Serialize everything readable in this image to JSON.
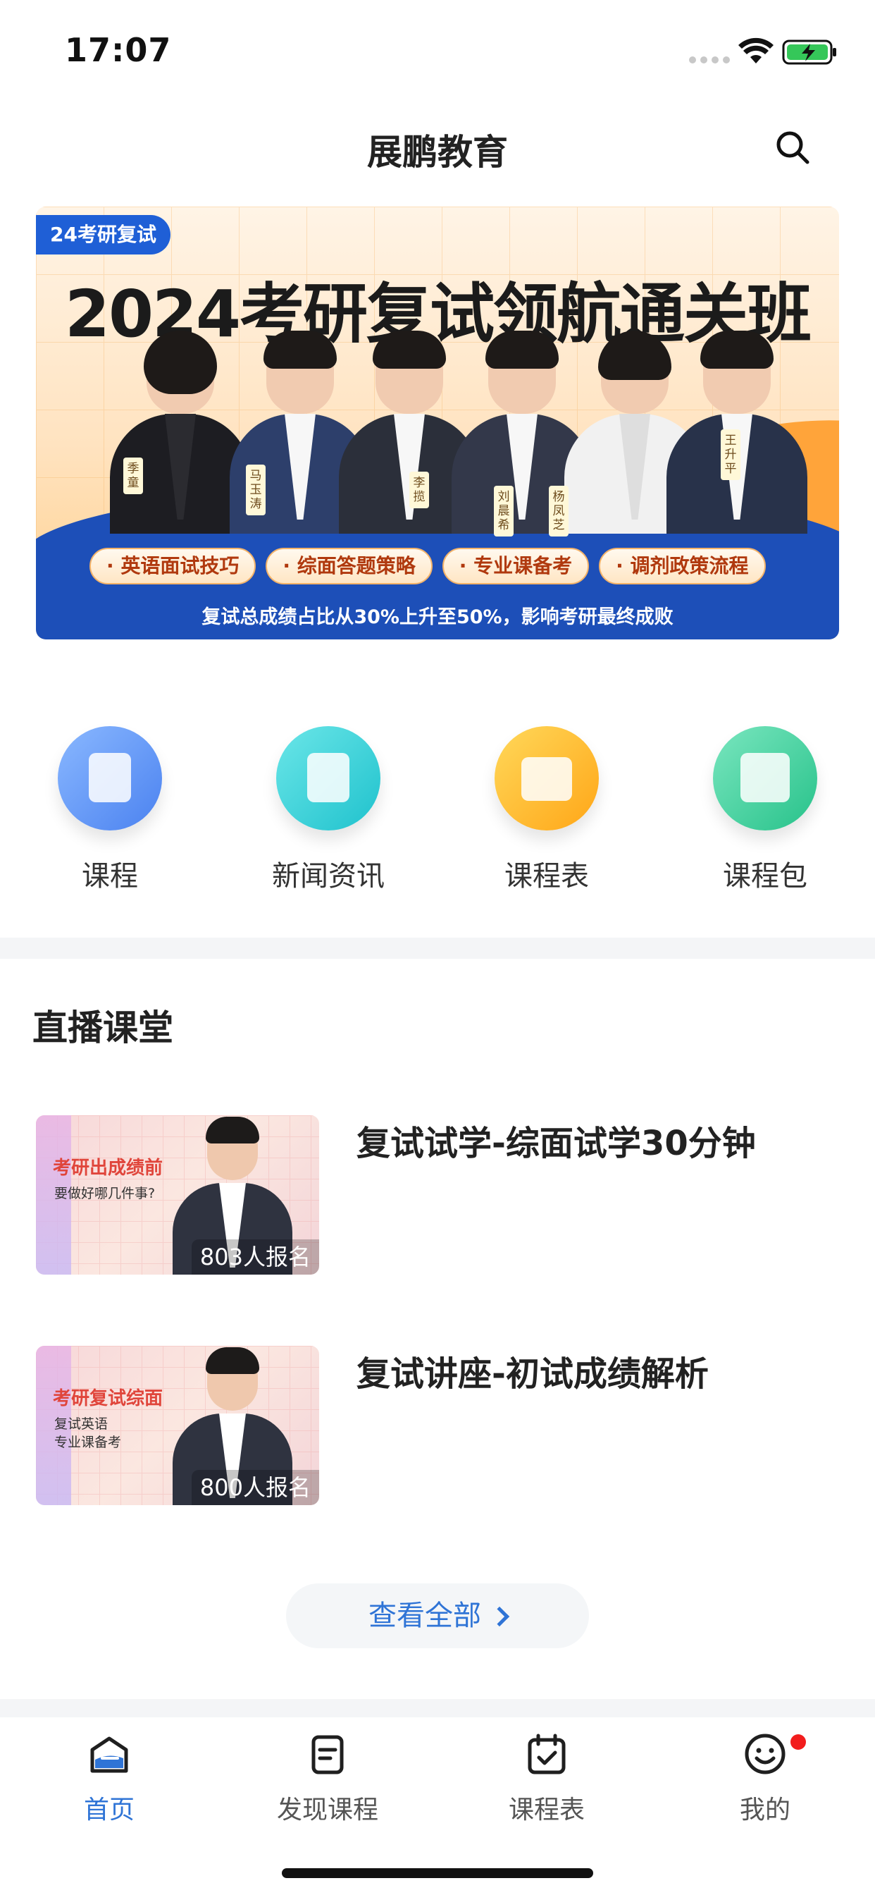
{
  "status_bar": {
    "time": "17:07"
  },
  "header": {
    "title": "展鹏教育"
  },
  "banner": {
    "tag": "24考研复试",
    "title": "2024考研复试领航通关班",
    "teachers": [
      "季童",
      "马玉涛",
      "李揽",
      "刘晨希",
      "杨凤芝",
      "王升平"
    ],
    "pills": [
      "· 英语面试技巧",
      "· 综面答题策略",
      "· 专业课备考",
      "· 调剂政策流程"
    ],
    "footer": "复试总成绩占比从30%上升至50%，影响考研最终成败"
  },
  "menu": [
    {
      "label": "课程",
      "color_from": "#7fb0ff",
      "color_to": "#4e86f2"
    },
    {
      "label": "新闻资讯",
      "color_from": "#5ee1e3",
      "color_to": "#20c4cf"
    },
    {
      "label": "课程表",
      "color_from": "#ffd54f",
      "color_to": "#ffaa1c"
    },
    {
      "label": "课程包",
      "color_from": "#6fe2b7",
      "color_to": "#2cc68f"
    }
  ],
  "live": {
    "section_title": "直播课堂",
    "items": [
      {
        "title": "复试试学-综面试学30分钟",
        "thumb_heading": "考研出成绩前",
        "thumb_sub": "要做好哪几件事?",
        "enroll": "803人报名"
      },
      {
        "title": "复试讲座-初试成绩解析",
        "thumb_heading": "考研复试综面",
        "thumb_sub": "复试英语\n专业课备考",
        "enroll": "800人报名"
      }
    ],
    "view_all": "查看全部"
  },
  "tabbar": {
    "items": [
      {
        "label": "首页",
        "active": true,
        "icon": "home-icon"
      },
      {
        "label": "发现课程",
        "active": false,
        "icon": "discover-icon"
      },
      {
        "label": "课程表",
        "active": false,
        "icon": "calendar-icon"
      },
      {
        "label": "我的",
        "active": false,
        "icon": "profile-icon"
      }
    ]
  },
  "colors": {
    "accent": "#2f74d6",
    "badge": "#f21d1d"
  }
}
